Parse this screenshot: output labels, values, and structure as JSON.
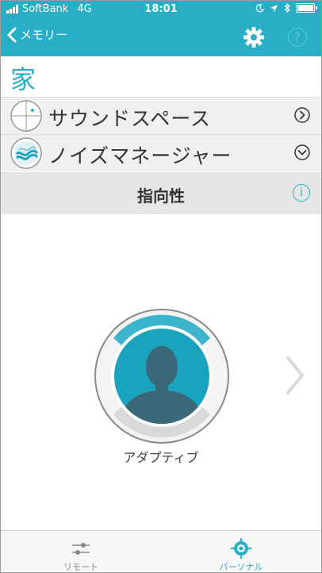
{
  "status_bar": {
    "carrier": "SoftBank",
    "network": "4G",
    "time": "18:01"
  },
  "nav": {
    "back_label": "メモリー",
    "help_glyph": "?",
    "icons": [
      "back-chevron-icon",
      "gear-icon",
      "help-icon"
    ]
  },
  "page": {
    "title": "家"
  },
  "menu": {
    "sound_space": {
      "label": "サウンドスペース",
      "icon": "sound-space-icon",
      "action_icon": "chevron-right-circle-icon"
    },
    "noise_manager": {
      "label": "ノイズマネージャー",
      "icon": "noise-manager-icon",
      "action_icon": "chevron-down-circle-icon"
    },
    "directivity": {
      "label": "指向性",
      "info_glyph": "i"
    }
  },
  "dial": {
    "mode_label": "アダプティブ",
    "icon": "user-silhouette-icon"
  },
  "tabbar": {
    "tabs": [
      {
        "label": "リモート",
        "icon": "sliders-icon",
        "active": false
      },
      {
        "label": "パーソナル",
        "icon": "personal-target-icon",
        "active": true
      }
    ]
  },
  "colors": {
    "accent": "#29aec8",
    "row_bg": "#f0f0f0",
    "header_row_bg": "#e6e6e6",
    "dial_fill": "#1aa3bd",
    "silhouette": "#3a6878"
  }
}
